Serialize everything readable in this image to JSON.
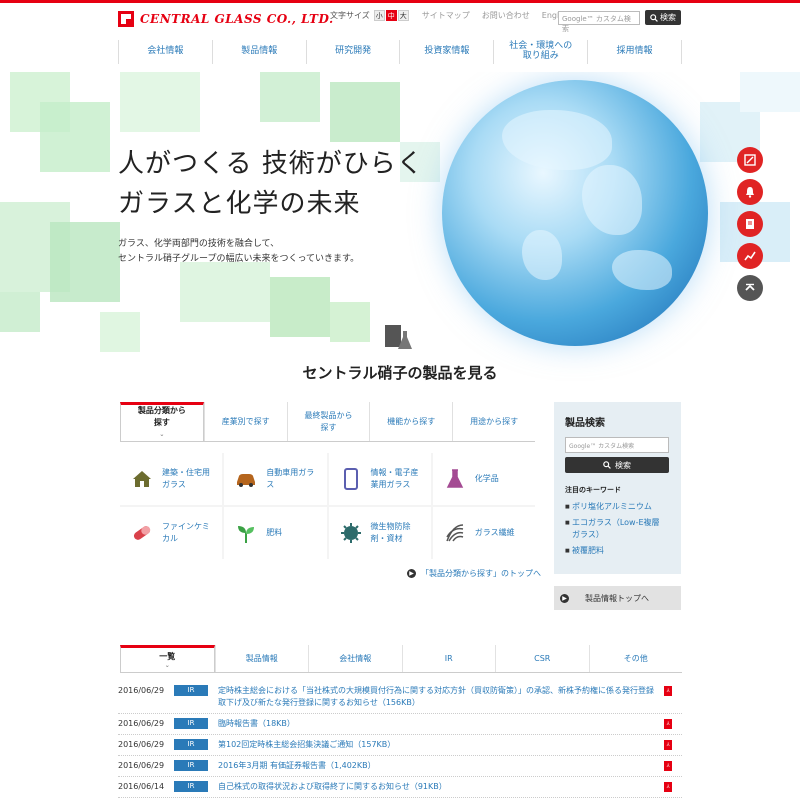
{
  "header": {
    "logo_text": "CENTRAL GLASS CO., LTD.",
    "font_size_label": "文字サイズ",
    "font_sizes": [
      "小",
      "中",
      "大"
    ],
    "sitemap": "サイトマップ",
    "contact": "お問い合わせ",
    "english": "English",
    "search_placeholder": "Google™ カスタム検索",
    "search_button": "検索"
  },
  "nav": [
    "会社情報",
    "製品情報",
    "研究開発",
    "投資家情報",
    "社会・環境への\n取り組み",
    "採用情報"
  ],
  "hero": {
    "title_line1": "人がつくる 技術がひらく",
    "title_line2": "ガラスと化学の未来",
    "sub_line1": "ガラス、化学両部門の技術を融合して、",
    "sub_line2": "セントラル硝子グループの幅広い未来をつくっていきます。"
  },
  "products": {
    "heading": "セントラル硝子の製品を見る",
    "tabs": [
      "製品分類から\n探す",
      "産業別で探す",
      "最終製品から\n探す",
      "機能から探す",
      "用途から探す"
    ],
    "categories": [
      {
        "label": "建築・住宅用\nガラス",
        "icon": "house-icon"
      },
      {
        "label": "自動車用ガラ\nス",
        "icon": "car-icon"
      },
      {
        "label": "情報・電子産\n業用ガラス",
        "icon": "tablet-icon"
      },
      {
        "label": "化学品",
        "icon": "flask-icon"
      },
      {
        "label": "ファインケミ\nカル",
        "icon": "capsule-icon"
      },
      {
        "label": "肥料",
        "icon": "sprout-icon"
      },
      {
        "label": "微生物防除\n剤・資材",
        "icon": "microbe-icon"
      },
      {
        "label": "ガラス繊維",
        "icon": "fiber-icon"
      }
    ],
    "category_top_link": "「製品分類から探す」のトップへ"
  },
  "product_search": {
    "title": "製品検索",
    "placeholder": "Google™ カスタム検索",
    "button": "検索",
    "keywords_title": "注目のキーワード",
    "keywords": [
      "ポリ塩化アルミニウム",
      "エコガラス（Low-E複層\nガラス）",
      "被覆肥料"
    ],
    "top_link": "製品情報トップへ"
  },
  "news": {
    "tabs": [
      "一覧",
      "製品情報",
      "会社情報",
      "IR",
      "CSR",
      "その他"
    ],
    "items": [
      {
        "date": "2016/06/29",
        "tag": "IR",
        "title": "定時株主総会における「当社株式の大規模買付行為に関する対応方針（買収防衛策）」の承認、新株予約権に係る発行登録取下げ及び新たな発行登録に関するお知らせ（156KB）"
      },
      {
        "date": "2016/06/29",
        "tag": "IR",
        "title": "臨時報告書（18KB）"
      },
      {
        "date": "2016/06/29",
        "tag": "IR",
        "title": "第102回定時株主総会招集決議ご通知（157KB）"
      },
      {
        "date": "2016/06/29",
        "tag": "IR",
        "title": "2016年3月期 有価証券報告書（1,402KB）"
      },
      {
        "date": "2016/06/14",
        "tag": "IR",
        "title": "自己株式の取得状況および取得終了に関するお知らせ（91KB）"
      }
    ]
  },
  "colors": {
    "brand_red": "#e60012",
    "link_blue": "#2a7ab8",
    "tag_blue": "#2a7ab8"
  }
}
